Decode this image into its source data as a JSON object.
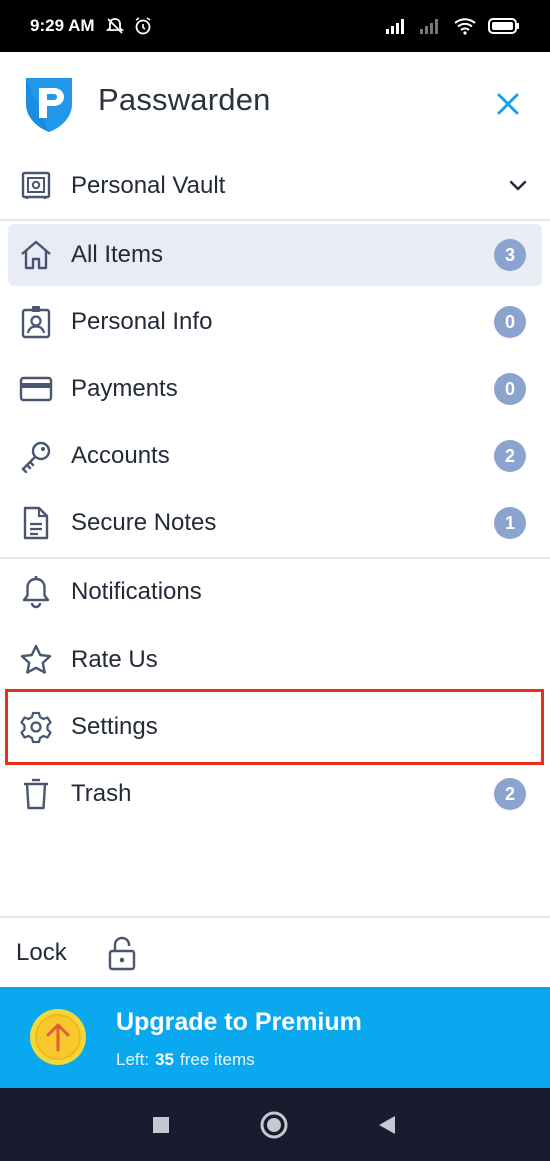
{
  "status_bar": {
    "time": "9:29 AM"
  },
  "header": {
    "app_name": "Passwarden"
  },
  "vault": {
    "label": "Personal Vault"
  },
  "nav_items": [
    {
      "label": "All Items",
      "count": "3",
      "icon": "home-icon"
    },
    {
      "label": "Personal Info",
      "count": "0",
      "icon": "id-card-icon"
    },
    {
      "label": "Payments",
      "count": "0",
      "icon": "credit-card-icon"
    },
    {
      "label": "Accounts",
      "count": "2",
      "icon": "key-icon"
    },
    {
      "label": "Secure Notes",
      "count": "1",
      "icon": "document-icon"
    }
  ],
  "secondary_items": [
    {
      "label": "Notifications",
      "icon": "bell-icon"
    },
    {
      "label": "Rate Us",
      "icon": "star-icon"
    },
    {
      "label": "Settings",
      "icon": "gear-icon"
    },
    {
      "label": "Trash",
      "count": "2",
      "icon": "trash-icon"
    }
  ],
  "lock": {
    "label": "Lock"
  },
  "premium": {
    "title": "Upgrade to Premium",
    "left_label": "Left:",
    "count": "35",
    "suffix": "free items"
  },
  "colors": {
    "accent": "#0aa9ef",
    "badge": "#8ba3cf",
    "highlight": "#e8311a",
    "active_bg": "#e8ecf4"
  }
}
